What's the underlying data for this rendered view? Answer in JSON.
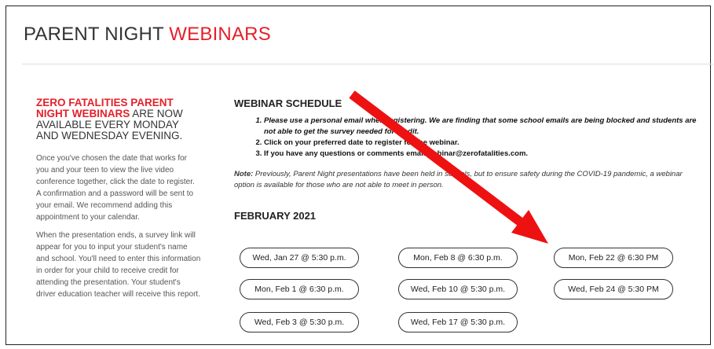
{
  "header": {
    "title_prefix": "PARENT NIGHT ",
    "title_highlight": "WEBINARS"
  },
  "left": {
    "heading_red": "ZERO FATALITIES PARENT NIGHT WEBINARS",
    "heading_rest": " ARE NOW AVAILABLE EVERY MONDAY AND WEDNESDAY EVENING.",
    "para1": "Once you've chosen the date that works for you and your teen to view the live video conference together, click the date to register. A confirmation and a password will be sent to your email. We recommend adding this appointment to your calendar.",
    "para2": "When the presentation ends, a survey link will appear for you to input your student's name and school. You'll need to enter this information in order for your child to receive credit for attending the presentation. Your student's driver education teacher will receive this report."
  },
  "schedule": {
    "heading": "WEBINAR SCHEDULE",
    "items": [
      "Please use a personal email when registering. We are finding that some school emails are being blocked and students are not able to get the survey needed for credit.",
      "Click on your preferred date to register for the webinar.",
      "If you have any questions or comments email webinar@zerofatalities.com."
    ],
    "note_label": "Note:",
    "note_text": " Previously, Parent Night presentations have been held in schools, but to ensure safety during the COVID-19 pandemic, a webinar option is available for those who are not able to meet in person.",
    "month": "FEBRUARY 2021"
  },
  "dates": {
    "col1": [
      "Wed, Jan 27 @ 5:30 p.m.",
      "Mon, Feb 1 @ 6:30 p.m.",
      "Wed, Feb 3 @ 5:30 p.m."
    ],
    "col2": [
      "Mon, Feb 8 @ 6:30 p.m.",
      "Wed, Feb 10 @ 5:30 p.m.",
      "Wed, Feb 17 @ 5:30 p.m."
    ],
    "col3": [
      "Mon, Feb 22 @ 6:30 PM",
      "Wed, Feb 24 @ 5:30 PM"
    ]
  },
  "colors": {
    "accent_red": "#e5202a",
    "annotation_arrow": "#ee1111"
  }
}
